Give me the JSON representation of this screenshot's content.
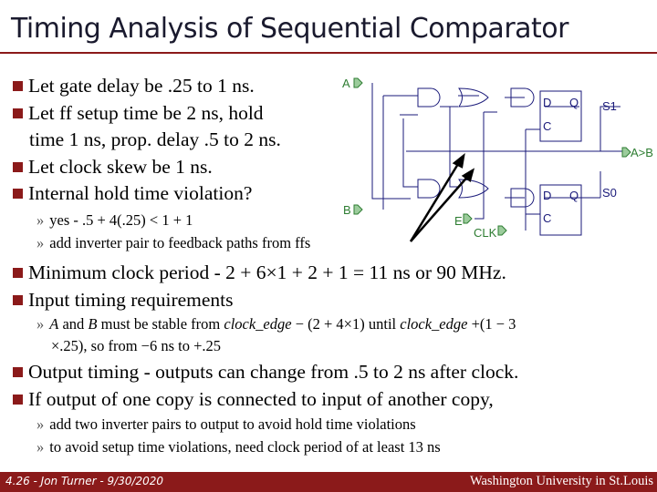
{
  "title": "Timing Analysis of Sequential Comparator",
  "bullets": [
    "Let gate delay be .25 to 1 ns.",
    "Let ff setup time be 2 ns, hold",
    "time 1 ns, prop. delay .5 to 2 ns.",
    "Let clock skew be 1 ns.",
    "Internal hold time violation?"
  ],
  "sub1": [
    "yes - .5 + 4(.25) < 1 + 1",
    "add inverter pair to feedback paths from ffs"
  ],
  "bullets2": [
    "Minimum clock period - 2 + 6×1 + 2 + 1 = 11 ns or 90 MHz.",
    "Input timing requirements"
  ],
  "sub2": {
    "a": "A",
    "and": " and ",
    "b": "B",
    "t1": " must be stable from ",
    "ce1": "clock_edge",
    "t2": " − (2 + 4×1) until ",
    "ce2": "clock_edge",
    "t3": " +(1 − 3",
    "line2": "×.25), so from −6 ns to +.25"
  },
  "bullets3": [
    "Output timing - outputs can change from .5 to 2 ns after clock.",
    "If output of one copy is connected to input of another copy,"
  ],
  "sub3": [
    "add two inverter pairs to output to avoid hold time violations",
    "to avoid setup time violations, need clock period of at least 13 ns"
  ],
  "circuit": {
    "a": "A",
    "b": "B",
    "e": "E",
    "clk": "CLK",
    "d": "D",
    "q": "Q",
    "c": "C",
    "s1": "S1",
    "s0": "S0",
    "agtb": "A>B"
  },
  "sub_marker": "»",
  "footer": {
    "left": "4.26 - Jon Turner - 9/30/2020",
    "right": "Washington University in St.Louis"
  },
  "colors": {
    "accent": "#8b1a1a",
    "wire": "#1a1a7a",
    "label": "#2e7d32"
  }
}
